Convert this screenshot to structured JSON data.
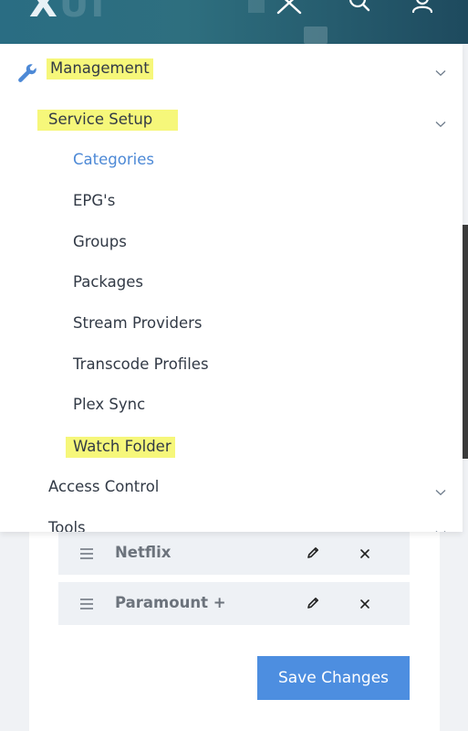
{
  "header": {
    "logo_x": "X",
    "logo_ui": "UI",
    "icons": [
      "close-icon",
      "search-icon",
      "user-icon"
    ]
  },
  "menu": {
    "management": {
      "label": "Management",
      "icon": "wrench-icon"
    },
    "service_setup": {
      "label": "Service Setup"
    },
    "sub_items": [
      {
        "label": "Categories",
        "active": true
      },
      {
        "label": "EPG's"
      },
      {
        "label": "Groups"
      },
      {
        "label": "Packages"
      },
      {
        "label": "Stream Providers"
      },
      {
        "label": "Transcode Profiles"
      },
      {
        "label": "Plex Sync"
      },
      {
        "label": "Watch Folder",
        "highlighted": true
      }
    ],
    "access_control": {
      "label": "Access Control"
    },
    "tools": {
      "label": "Tools"
    }
  },
  "list": {
    "rows": [
      {
        "name": "Netflix"
      },
      {
        "name": "Paramount +"
      }
    ]
  },
  "actions": {
    "save_label": "Save Changes"
  },
  "colors": {
    "accent": "#4d8ee0",
    "active_link": "#4d89d6",
    "highlight": "#f6f77a",
    "header_start": "#2a6d83",
    "header_end": "#1e4a5e"
  }
}
